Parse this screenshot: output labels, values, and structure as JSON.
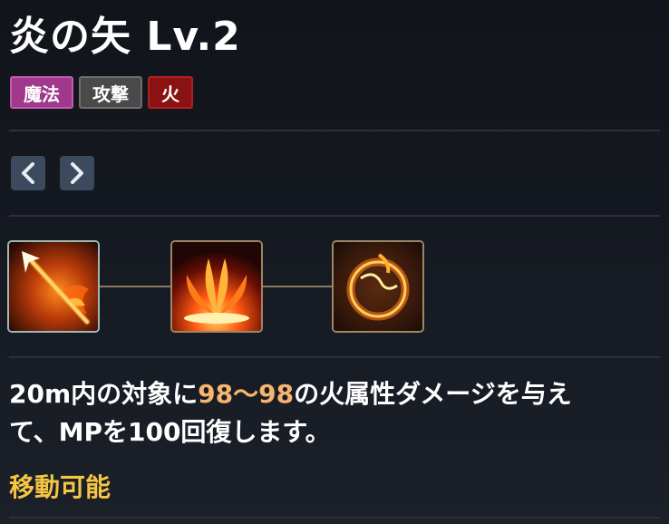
{
  "skill": {
    "name": "炎の矢",
    "level": "Lv.2"
  },
  "tags": [
    {
      "label": "魔法",
      "bg": "#a0398c",
      "border": "#c45ab0"
    },
    {
      "label": "攻撃",
      "bg": "#4a4a4a",
      "border": "#6e6e6e"
    },
    {
      "label": "火",
      "bg": "#8a1212",
      "border": "#b02020"
    }
  ],
  "navigation": {
    "prev_icon": "chevron-left-icon",
    "next_icon": "chevron-right-icon"
  },
  "skill_tree": [
    {
      "icon": "flaming-arrow-icon",
      "selected": true
    },
    {
      "icon": "fire-burst-icon",
      "selected": false
    },
    {
      "icon": "fire-ring-icon",
      "selected": false
    }
  ],
  "description": {
    "part1": "20m内の対象に",
    "damage": "98〜98",
    "part2": "の火属性ダメージを与え",
    "line2": "て、MPを100回復します。"
  },
  "status": "移動可能",
  "colors": {
    "highlight": "#f5b56e",
    "status": "#f5c544",
    "selected_border": "#9fb8b4",
    "skill_border": "#9c8666"
  }
}
